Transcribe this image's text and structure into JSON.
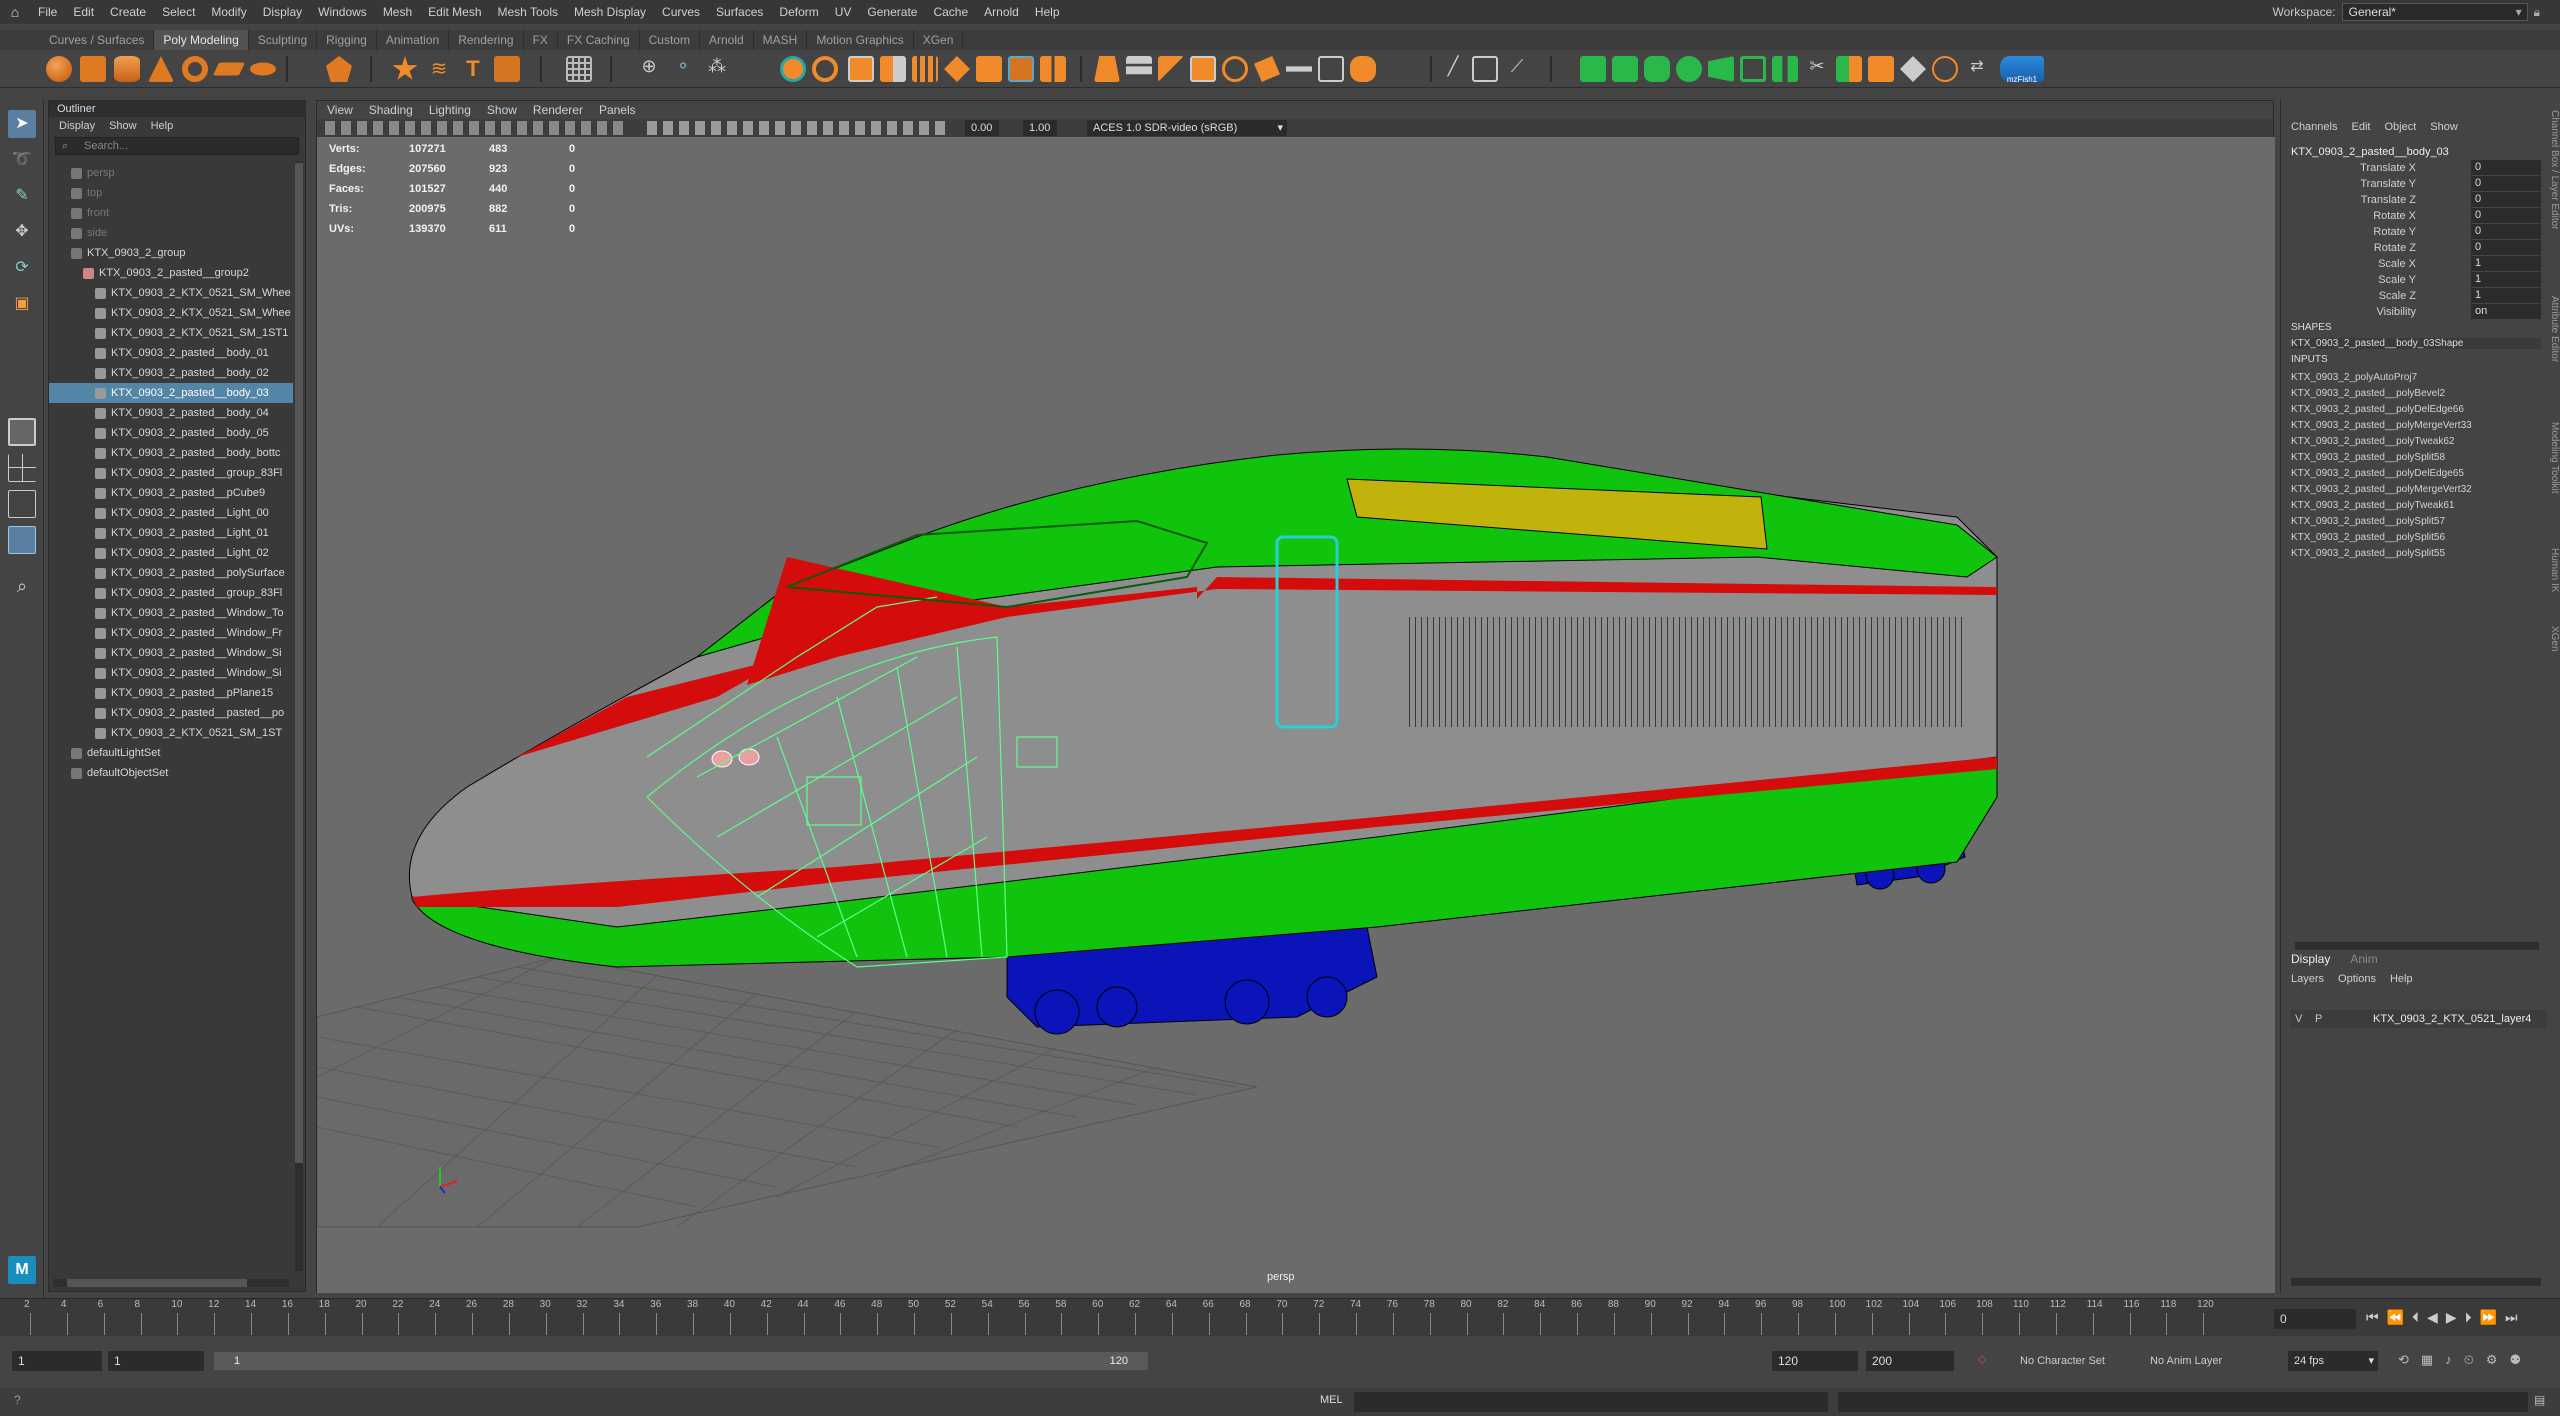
{
  "menubar": {
    "items": [
      "File",
      "Edit",
      "Create",
      "Select",
      "Modify",
      "Display",
      "Windows",
      "Mesh",
      "Edit Mesh",
      "Mesh Tools",
      "Mesh Display",
      "Curves",
      "Surfaces",
      "Deform",
      "UV",
      "Generate",
      "Cache",
      "Arnold",
      "Help"
    ],
    "workspace_label": "Workspace:",
    "workspace_value": "General*"
  },
  "shelf_tabs": [
    "Curves / Surfaces",
    "Poly Modeling",
    "Sculpting",
    "Rigging",
    "Animation",
    "Rendering",
    "FX",
    "FX Caching",
    "Custom",
    "Arnold",
    "MASH",
    "Motion Graphics",
    "XGen"
  ],
  "shelf_active": "Poly Modeling",
  "shelf_last_label": "mzFish1",
  "outliner": {
    "title": "Outliner",
    "menu": [
      "Display",
      "Show",
      "Help"
    ],
    "search_placeholder": "Search...",
    "items": [
      {
        "label": "persp",
        "indent": 1,
        "dim": true
      },
      {
        "label": "top",
        "indent": 1,
        "dim": true
      },
      {
        "label": "front",
        "indent": 1,
        "dim": true
      },
      {
        "label": "side",
        "indent": 1,
        "dim": true
      },
      {
        "label": "KTX_0903_2_group",
        "indent": 1,
        "dim": false
      },
      {
        "label": "KTX_0903_2_pasted__group2",
        "indent": 2,
        "dim": false
      },
      {
        "label": "KTX_0903_2_KTX_0521_SM_Whee",
        "indent": 3,
        "dim": false
      },
      {
        "label": "KTX_0903_2_KTX_0521_SM_Whee",
        "indent": 3,
        "dim": false
      },
      {
        "label": "KTX_0903_2_KTX_0521_SM_1ST1",
        "indent": 3,
        "dim": false
      },
      {
        "label": "KTX_0903_2_pasted__body_01",
        "indent": 3,
        "dim": false
      },
      {
        "label": "KTX_0903_2_pasted__body_02",
        "indent": 3,
        "dim": false
      },
      {
        "label": "KTX_0903_2_pasted__body_03",
        "indent": 3,
        "dim": false,
        "selected": true
      },
      {
        "label": "KTX_0903_2_pasted__body_04",
        "indent": 3,
        "dim": false
      },
      {
        "label": "KTX_0903_2_pasted__body_05",
        "indent": 3,
        "dim": false
      },
      {
        "label": "KTX_0903_2_pasted__body_bottc",
        "indent": 3,
        "dim": false
      },
      {
        "label": "KTX_0903_2_pasted__group_83Fl",
        "indent": 3,
        "dim": false
      },
      {
        "label": "KTX_0903_2_pasted__pCube9",
        "indent": 3,
        "dim": false
      },
      {
        "label": "KTX_0903_2_pasted__Light_00",
        "indent": 3,
        "dim": false
      },
      {
        "label": "KTX_0903_2_pasted__Light_01",
        "indent": 3,
        "dim": false
      },
      {
        "label": "KTX_0903_2_pasted__Light_02",
        "indent": 3,
        "dim": false
      },
      {
        "label": "KTX_0903_2_pasted__polySurface",
        "indent": 3,
        "dim": false
      },
      {
        "label": "KTX_0903_2_pasted__group_83Fl",
        "indent": 3,
        "dim": false
      },
      {
        "label": "KTX_0903_2_pasted__Window_To",
        "indent": 3,
        "dim": false
      },
      {
        "label": "KTX_0903_2_pasted__Window_Fr",
        "indent": 3,
        "dim": false
      },
      {
        "label": "KTX_0903_2_pasted__Window_Si",
        "indent": 3,
        "dim": false
      },
      {
        "label": "KTX_0903_2_pasted__Window_Si",
        "indent": 3,
        "dim": false
      },
      {
        "label": "KTX_0903_2_pasted__pPlane15",
        "indent": 3,
        "dim": false
      },
      {
        "label": "KTX_0903_2_pasted__pasted__po",
        "indent": 3,
        "dim": false
      },
      {
        "label": "KTX_0903_2_KTX_0521_SM_1ST",
        "indent": 3,
        "dim": false
      },
      {
        "label": "defaultLightSet",
        "indent": 1,
        "dim": false
      },
      {
        "label": "defaultObjectSet",
        "indent": 1,
        "dim": false
      }
    ]
  },
  "viewport": {
    "menu": [
      "View",
      "Shading",
      "Lighting",
      "Show",
      "Renderer",
      "Panels"
    ],
    "exposure": "0.00",
    "gamma": "1.00",
    "colorspace": "ACES 1.0 SDR-video (sRGB)",
    "camera_label": "persp",
    "hud": [
      {
        "label": "Verts:",
        "a": "107271",
        "b": "483",
        "c": "0"
      },
      {
        "label": "Edges:",
        "a": "207560",
        "b": "923",
        "c": "0"
      },
      {
        "label": "Faces:",
        "a": "101527",
        "b": "440",
        "c": "0"
      },
      {
        "label": "Tris:",
        "a": "200975",
        "b": "882",
        "c": "0"
      },
      {
        "label": "UVs:",
        "a": "139370",
        "b": "611",
        "c": "0"
      }
    ]
  },
  "channelbox": {
    "menu": [
      "Channels",
      "Edit",
      "Object",
      "Show"
    ],
    "object_name": "KTX_0903_2_pasted__body_03",
    "channels": [
      {
        "label": "Translate X",
        "value": "0"
      },
      {
        "label": "Translate Y",
        "value": "0"
      },
      {
        "label": "Translate Z",
        "value": "0"
      },
      {
        "label": "Rotate X",
        "value": "0"
      },
      {
        "label": "Rotate Y",
        "value": "0"
      },
      {
        "label": "Rotate Z",
        "value": "0"
      },
      {
        "label": "Scale X",
        "value": "1"
      },
      {
        "label": "Scale Y",
        "value": "1"
      },
      {
        "label": "Scale Z",
        "value": "1"
      },
      {
        "label": "Visibility",
        "value": "on"
      }
    ],
    "shapes_header": "SHAPES",
    "shape_name": "KTX_0903_2_pasted__body_03Shape",
    "inputs_header": "INPUTS",
    "inputs": [
      "KTX_0903_2_polyAutoProj7",
      "KTX_0903_2_pasted__polyBevel2",
      "KTX_0903_2_pasted__polyDelEdge66",
      "KTX_0903_2_pasted__polyMergeVert33",
      "KTX_0903_2_pasted__polyTweak62",
      "KTX_0903_2_pasted__polySplit58",
      "KTX_0903_2_pasted__polyDelEdge65",
      "KTX_0903_2_pasted__polyMergeVert32",
      "KTX_0903_2_pasted__polyTweak61",
      "KTX_0903_2_pasted__polySplit57",
      "KTX_0903_2_pasted__polySplit56",
      "KTX_0903_2_pasted__polySplit55"
    ],
    "side_tabs": [
      "Channel Box / Layer Editor",
      "Attribute Editor",
      "Modeling Toolkit",
      "Human IK",
      "XGen"
    ]
  },
  "layers": {
    "tabs": [
      "Display",
      "Anim"
    ],
    "menu": [
      "Layers",
      "Options",
      "Help"
    ],
    "row_v": "V",
    "row_p": "P",
    "layer_name": "KTX_0903_2_KTX_0521_layer4"
  },
  "timeline": {
    "ticks": [
      "2",
      "4",
      "6",
      "8",
      "10",
      "12",
      "14",
      "16",
      "18",
      "20",
      "22",
      "24",
      "26",
      "28",
      "30",
      "32",
      "34",
      "36",
      "38",
      "40",
      "42",
      "44",
      "46",
      "48",
      "50",
      "52",
      "54",
      "56",
      "58",
      "60",
      "62",
      "64",
      "66",
      "68",
      "70",
      "72",
      "74",
      "76",
      "78",
      "80",
      "82",
      "84",
      "86",
      "88",
      "90",
      "92",
      "94",
      "96",
      "98",
      "100",
      "102",
      "104",
      "106",
      "108",
      "110",
      "112",
      "114",
      "116",
      "118",
      "120"
    ],
    "current_frame": "0"
  },
  "range": {
    "start": "1",
    "start2": "1",
    "slider_start": "1",
    "slider_end": "120",
    "end": "120",
    "end2": "200",
    "character_set": "No Character Set",
    "anim_layer": "No Anim Layer",
    "fps": "24 fps"
  },
  "cmdline": {
    "mode": "MEL"
  },
  "colors": {
    "accent": "#5285a6",
    "train_green": "#10c40e",
    "train_red": "#d40c0c",
    "train_blue": "#0b14b8",
    "train_grey": "#8e8e8e",
    "window_yellow": "#c2b20c"
  }
}
